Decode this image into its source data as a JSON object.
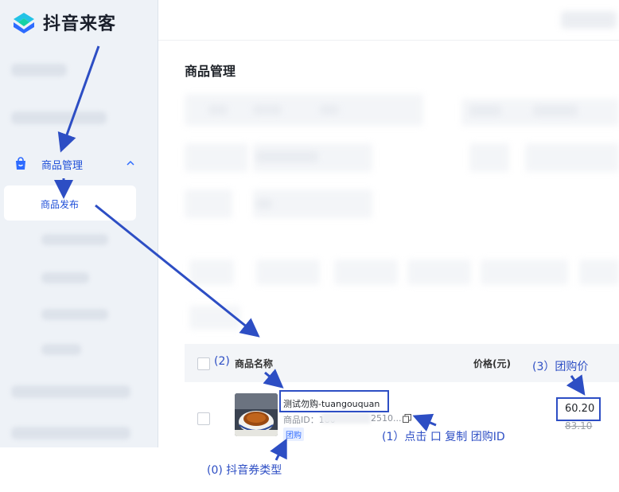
{
  "app": {
    "brand": "抖音来客"
  },
  "sidebar": {
    "group": {
      "label": "商品管理",
      "icon": "shopping-bag-icon",
      "expanded": true
    },
    "active_item": {
      "label": "商品发布"
    }
  },
  "main": {
    "title": "商品管理",
    "table": {
      "columns": {
        "name": "商品名称",
        "price": "价格(元)"
      },
      "row": {
        "name": "测试勿购-tuangouquan",
        "id_prefix": "商品ID：180",
        "id_suffix": "2510...",
        "tag": "团购",
        "price": "60.20",
        "original_price": "83.10"
      }
    }
  },
  "annotations": {
    "label0": "(0) 抖音券类型",
    "label1": "(1）点击 口 复制 团购ID",
    "label2": "(2)",
    "label3": "(3）团购价",
    "color": "#2d4ec4"
  }
}
